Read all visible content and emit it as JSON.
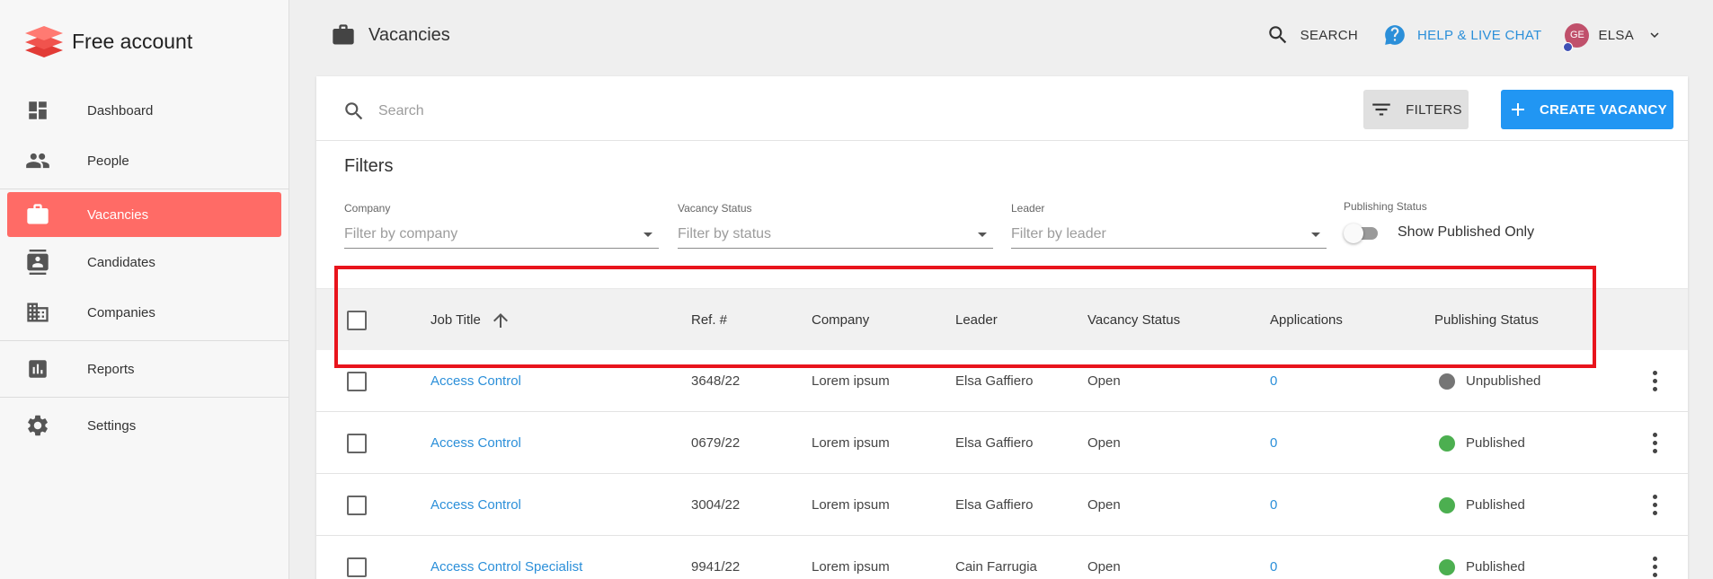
{
  "brand": {
    "name": "Free account"
  },
  "sidebar": {
    "items": [
      {
        "label": "Dashboard",
        "icon": "dashboard-icon"
      },
      {
        "label": "People",
        "icon": "people-icon"
      },
      {
        "label": "Vacancies",
        "icon": "briefcase-icon",
        "active": true
      },
      {
        "label": "Candidates",
        "icon": "contact-card-icon"
      },
      {
        "label": "Companies",
        "icon": "building-icon"
      },
      {
        "label": "Reports",
        "icon": "bar-chart-icon"
      },
      {
        "label": "Settings",
        "icon": "gear-icon"
      }
    ]
  },
  "header": {
    "title": "Vacancies",
    "search_label": "SEARCH",
    "help_label": "HELP & LIVE CHAT",
    "user_initials": "GE",
    "user_name": "ELSA"
  },
  "toolbar": {
    "search_placeholder": "Search",
    "filters_label": "FILTERS",
    "create_label": "CREATE VACANCY"
  },
  "filters": {
    "title": "Filters",
    "company": {
      "label": "Company",
      "placeholder": "Filter by company"
    },
    "status": {
      "label": "Vacancy Status",
      "placeholder": "Filter by status"
    },
    "leader": {
      "label": "Leader",
      "placeholder": "Filter by leader"
    },
    "publishing": {
      "label": "Publishing Status",
      "toggle_label": "Show Published Only",
      "on": false
    }
  },
  "table": {
    "columns": [
      "Job Title",
      "Ref. #",
      "Company",
      "Leader",
      "Vacancy Status",
      "Applications",
      "Publishing Status"
    ],
    "rows": [
      {
        "title": "Access Control",
        "ref": "3648/22",
        "company": "Lorem ipsum",
        "leader": "Elsa Gaffiero",
        "status": "Open",
        "applications": "0",
        "publishing": "Unpublished"
      },
      {
        "title": "Access Control",
        "ref": "0679/22",
        "company": "Lorem ipsum",
        "leader": "Elsa Gaffiero",
        "status": "Open",
        "applications": "0",
        "publishing": "Published"
      },
      {
        "title": "Access Control",
        "ref": "3004/22",
        "company": "Lorem ipsum",
        "leader": "Elsa Gaffiero",
        "status": "Open",
        "applications": "0",
        "publishing": "Published"
      },
      {
        "title": "Access Control Specialist",
        "ref": "9941/22",
        "company": "Lorem ipsum",
        "leader": "Cain Farrugia",
        "status": "Open",
        "applications": "0",
        "publishing": "Published"
      }
    ]
  },
  "colors": {
    "accent": "#ff6b66",
    "primary": "#2196f3",
    "link": "#2b8fd9",
    "published": "#4caf50",
    "unpublished": "#757575",
    "highlight": "#e8141c"
  }
}
